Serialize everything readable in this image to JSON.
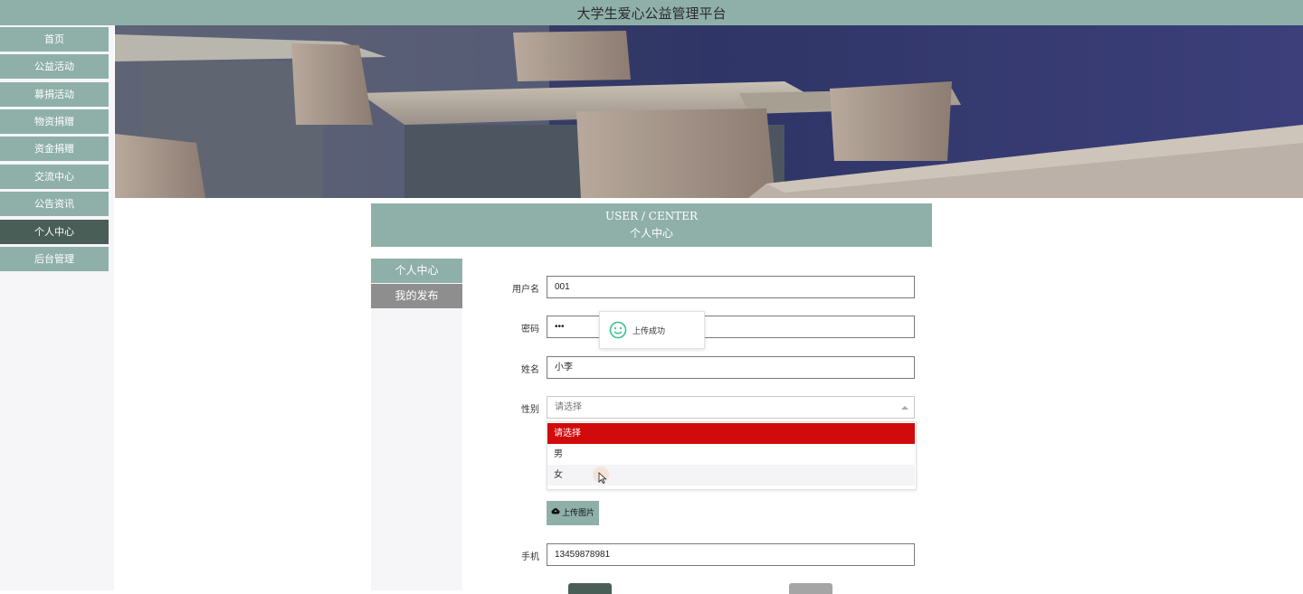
{
  "header": {
    "title": "大学生爱心公益管理平台"
  },
  "sidebar": {
    "items": [
      {
        "label": "首页"
      },
      {
        "label": "公益活动"
      },
      {
        "label": "募捐活动"
      },
      {
        "label": "物资捐赠"
      },
      {
        "label": "资金捐赠"
      },
      {
        "label": "交流中心"
      },
      {
        "label": "公告资讯"
      },
      {
        "label": "个人中心",
        "active": true
      },
      {
        "label": "后台管理"
      }
    ]
  },
  "center": {
    "title_en": "USER / CENTER",
    "title_cn": "个人中心"
  },
  "subnav": {
    "items": [
      {
        "label": "个人中心"
      },
      {
        "label": "我的发布"
      }
    ]
  },
  "form": {
    "username": {
      "label": "用户名",
      "value": "001"
    },
    "password": {
      "label": "密码",
      "value": "•••"
    },
    "name": {
      "label": "姓名",
      "value": "小李"
    },
    "gender": {
      "label": "性别",
      "placeholder": "请选择",
      "options": [
        "请选择",
        "男",
        "女"
      ],
      "highlighted": "请选择"
    },
    "upload": {
      "label": "上传图片"
    },
    "phone": {
      "label": "手机",
      "value": "13459878981"
    }
  },
  "toast": {
    "message": "上传成功"
  },
  "colors": {
    "accent": "#8fb0a9",
    "active": "#4a5e58",
    "selected_option": "#d10b0b",
    "secondary": "#8e8e8e"
  }
}
